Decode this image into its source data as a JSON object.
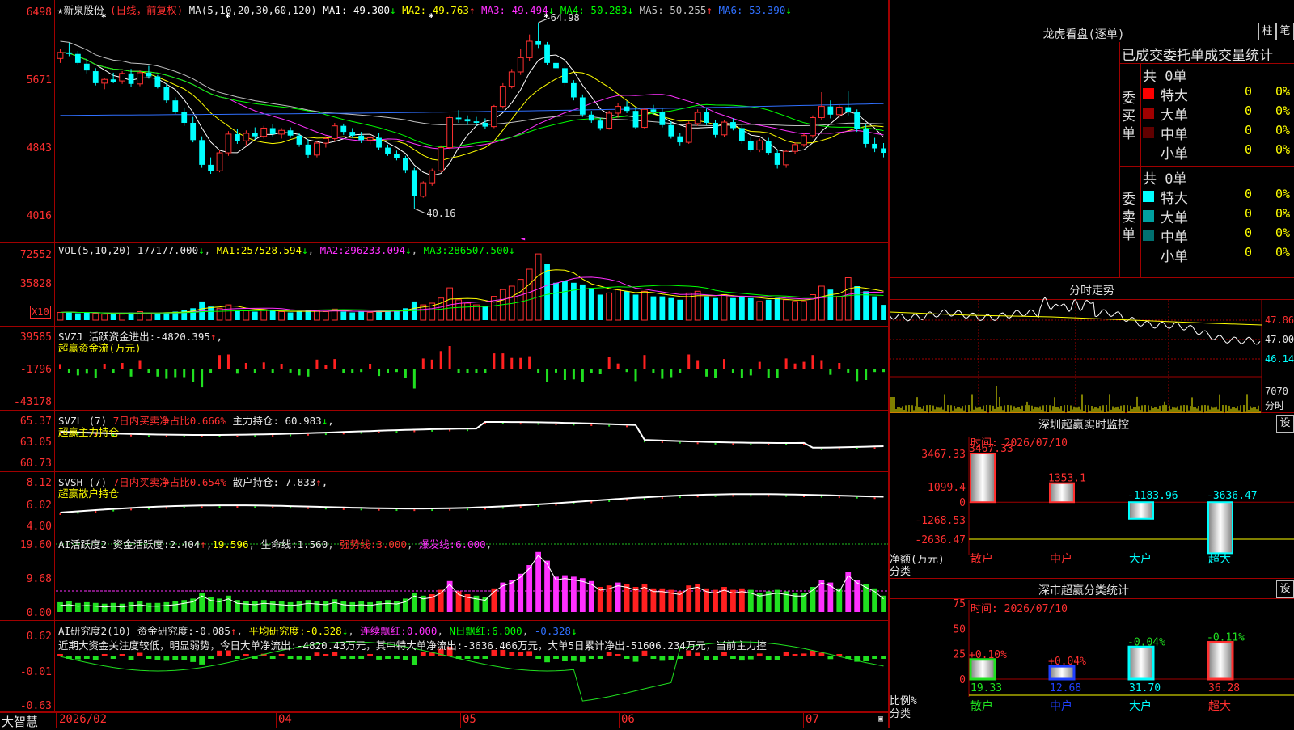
{
  "stock": {
    "name": "新泉股份",
    "period": "(日线，前复权)"
  },
  "main": {
    "ma_title": "MA(5,10,20,30,60,120)",
    "ma": [
      {
        "label": "MA1:",
        "value": "49.300",
        "dir": "↓",
        "color": "#ffffff"
      },
      {
        "label": "MA2:",
        "value": "49.763",
        "dir": "↑",
        "color": "#ffff00"
      },
      {
        "label": "MA3:",
        "value": "49.494",
        "dir": "↓",
        "color": "#ff30ff"
      },
      {
        "label": "MA4:",
        "value": "50.283",
        "dir": "↓",
        "color": "#00ff00"
      },
      {
        "label": "MA5:",
        "value": "50.255",
        "dir": "↑",
        "color": "#c0c0c0"
      },
      {
        "label": "MA6:",
        "value": "53.390",
        "dir": "↓",
        "color": "#3070ff"
      }
    ],
    "y_labels": [
      "6498",
      "5671",
      "4843",
      "4016"
    ],
    "high_mark": "64.98",
    "low_mark": "40.16"
  },
  "vol": {
    "title": "VOL(5,10,20)",
    "value": "177177.000",
    "value_dir": "↓",
    "ma1": "257528.594",
    "ma1_dir": "↓",
    "ma2": "296233.094",
    "ma2_dir": "↓",
    "ma3": "286507.500",
    "ma3_dir": "↓",
    "y_labels": [
      "72552",
      "35828"
    ],
    "unit": "X10"
  },
  "svzj": {
    "title": "SVZJ",
    "text": "活跃资金进出:",
    "value": "-4820.395",
    "dir": "↑",
    "sep": ",",
    "subtitle": "超赢资金流(万元)",
    "y_labels": [
      "39585",
      "-1796",
      "-43178"
    ]
  },
  "svzl": {
    "title": "SVZL (7)",
    "ratio_text": "7日内买卖净占比0.666%",
    "hold_label": "主力持仓:",
    "hold_value": "60.983",
    "dir": "↓",
    "sep": ",",
    "subtitle": "超赢主力持仓",
    "y_labels": [
      "65.37",
      "63.05",
      "60.73"
    ]
  },
  "svsh": {
    "title": "SVSH (7)",
    "ratio_text": "7日内买卖净占比0.654%",
    "hold_label": "散户持仓:",
    "hold_value": "7.833",
    "dir": "↑",
    "sep": ",",
    "subtitle": "超赢散户持仓",
    "y_labels": [
      "8.12",
      "6.02",
      "4.00"
    ]
  },
  "ai_act": {
    "title": "AI活跃度2",
    "act_label": "资金活跃度:",
    "act_value": "2.404",
    "act_dir": "↑",
    "val2": "19.596",
    "life_label": "生命线:",
    "life_value": "1.560",
    "strong_label": "强势线:",
    "strong_value": "3.000",
    "burst_label": "爆发线:",
    "burst_value": "6.000",
    "y_labels": [
      "19.60",
      "9.68",
      "0.00"
    ]
  },
  "ai_res": {
    "title": "AI研究度2(10)",
    "res_label": "资金研究度:",
    "res_value": "-0.085",
    "res_dir": "↑",
    "avg_label": "平均研究度:",
    "avg_value": "-0.328",
    "avg_dir": "↓",
    "lx_label": "连续飘红:",
    "lx_value": "0.000",
    "n_label": "N日飘红:",
    "n_value": "6.000",
    "last_value": "-0.328",
    "last_dir": "↓",
    "comment": "近期大资金关注度较低，明显弱势，今日大单净流出:-4820.43万元，其中特大单净流出:-3636.466万元，大单5日累计净出-51606.234万元，当前主力控",
    "y_labels": [
      "0.62",
      "-0.01",
      "-0.63"
    ]
  },
  "xaxis": {
    "brand": "大智慧",
    "labels": [
      "2026/02",
      "04",
      "05",
      "06",
      "07"
    ]
  },
  "lhb": {
    "title": "龙虎看盘(逐单)",
    "btn1": "柱",
    "btn2": "笔",
    "header": "已成交委托单成交量统计",
    "buy_label": "委买单",
    "sell_label": "委卖单",
    "buy_total": "共 0单",
    "sell_total": "共 0单",
    "buy_rows": [
      {
        "name": "特大",
        "count": "0",
        "pct": "0%",
        "color": "#ff0000"
      },
      {
        "name": "大单",
        "count": "0",
        "pct": "0%",
        "color": "#a00000"
      },
      {
        "name": "中单",
        "count": "0",
        "pct": "0%",
        "color": "#600000"
      },
      {
        "name": "小单",
        "count": "0",
        "pct": "0%",
        "color": ""
      }
    ],
    "sell_rows": [
      {
        "name": "特大",
        "count": "0",
        "pct": "0%",
        "color": "#00ffff"
      },
      {
        "name": "大单",
        "count": "0",
        "pct": "0%",
        "color": "#00a0a0"
      },
      {
        "name": "中单",
        "count": "0",
        "pct": "0%",
        "color": "#007070"
      },
      {
        "name": "小单",
        "count": "0",
        "pct": "0%",
        "color": ""
      }
    ]
  },
  "intraday": {
    "title": "分时走势",
    "y_labels": [
      "47.86",
      "47.00",
      "46.14"
    ],
    "vol_label": "7070",
    "time_label": "分时"
  },
  "sz_monitor": {
    "title": "深圳超赢实时监控",
    "set_btn": "设",
    "time": "时间: 2026/07/10",
    "y_labels": [
      "3467.33",
      "1099.4",
      "0",
      "-1268.53",
      "-2636.47"
    ],
    "unit_label": "净额(万元)",
    "class_label": "分类",
    "bars": [
      {
        "name": "散户",
        "value": 3467.33,
        "label": "3467.33"
      },
      {
        "name": "中户",
        "value": 1353.1,
        "label": "1353.1"
      },
      {
        "name": "大户",
        "value": -1183.96,
        "label": "-1183.96"
      },
      {
        "name": "超大",
        "value": -3636.47,
        "label": "-3636.47"
      }
    ]
  },
  "sz_class": {
    "title": "深市超赢分类统计",
    "set_btn": "设",
    "time": "时间: 2026/07/10",
    "y_labels": [
      "75",
      "50",
      "25",
      "0"
    ],
    "unit_label": "比例%",
    "class_label": "分类",
    "bars": [
      {
        "name": "散户",
        "value": 19.33,
        "label": "19.33",
        "chg": "+0.10%"
      },
      {
        "name": "中户",
        "value": 12.68,
        "label": "12.68",
        "chg": "+0.04%"
      },
      {
        "name": "大户",
        "value": 31.7,
        "label": "31.70",
        "chg": "-0.04%"
      },
      {
        "name": "超大",
        "value": 36.28,
        "label": "36.28",
        "chg": "-0.11%"
      }
    ]
  },
  "chart_data": {
    "type": "candlestick",
    "ohlc": [
      [
        60.2,
        61.5,
        59.6,
        61.0
      ],
      [
        61.0,
        62.3,
        60.5,
        60.8
      ],
      [
        60.8,
        61.2,
        59.4,
        59.6
      ],
      [
        59.5,
        60.2,
        58.2,
        58.6
      ],
      [
        58.5,
        58.9,
        56.6,
        56.9
      ],
      [
        56.9,
        57.6,
        56.1,
        57.4
      ],
      [
        57.4,
        58.3,
        56.9,
        57.1
      ],
      [
        57.2,
        58.5,
        56.8,
        58.2
      ],
      [
        58.2,
        58.8,
        56.4,
        56.8
      ],
      [
        56.8,
        58.6,
        56.5,
        58.3
      ],
      [
        58.3,
        59.2,
        57.5,
        57.8
      ],
      [
        57.8,
        58.0,
        56.2,
        56.4
      ],
      [
        56.4,
        56.8,
        54.2,
        54.6
      ],
      [
        54.6,
        55.0,
        52.8,
        53.1
      ],
      [
        53.1,
        53.6,
        51.2,
        51.6
      ],
      [
        51.6,
        52.4,
        49.0,
        49.3
      ],
      [
        49.3,
        49.8,
        45.6,
        46.0
      ],
      [
        46.0,
        47.0,
        44.8,
        45.2
      ],
      [
        45.2,
        48.0,
        45.0,
        47.6
      ],
      [
        47.6,
        50.5,
        47.2,
        50.1
      ],
      [
        50.1,
        50.8,
        48.8,
        49.2
      ],
      [
        49.2,
        50.6,
        48.6,
        50.2
      ],
      [
        50.2,
        51.0,
        49.4,
        49.8
      ],
      [
        49.8,
        51.2,
        49.5,
        50.9
      ],
      [
        50.9,
        51.4,
        49.8,
        50.1
      ],
      [
        50.1,
        50.9,
        49.5,
        50.6
      ],
      [
        50.6,
        51.0,
        49.6,
        49.9
      ],
      [
        49.9,
        50.3,
        48.4,
        48.7
      ],
      [
        48.7,
        49.4,
        46.9,
        47.3
      ],
      [
        47.3,
        49.2,
        47.0,
        48.9
      ],
      [
        48.9,
        49.8,
        48.3,
        49.5
      ],
      [
        49.5,
        51.6,
        49.2,
        51.2
      ],
      [
        51.2,
        51.5,
        50.0,
        50.4
      ],
      [
        50.4,
        50.9,
        49.6,
        49.9
      ],
      [
        49.9,
        50.4,
        48.9,
        49.3
      ],
      [
        49.3,
        50.0,
        48.7,
        49.6
      ],
      [
        49.6,
        50.2,
        48.0,
        48.3
      ],
      [
        48.3,
        48.7,
        47.2,
        47.5
      ],
      [
        47.5,
        47.9,
        46.6,
        46.9
      ],
      [
        46.9,
        47.2,
        44.9,
        45.3
      ],
      [
        45.3,
        45.6,
        40.16,
        41.8
      ],
      [
        41.8,
        43.8,
        41.6,
        43.6
      ],
      [
        43.6,
        45.5,
        43.2,
        45.2
      ],
      [
        45.2,
        48.6,
        45.0,
        48.3
      ],
      [
        48.3,
        52.6,
        48.1,
        52.3
      ],
      [
        52.3,
        53.3,
        51.6,
        52.1
      ],
      [
        52.1,
        52.6,
        51.3,
        51.8
      ],
      [
        51.8,
        52.4,
        51.2,
        51.6
      ],
      [
        51.6,
        52.2,
        50.8,
        51.1
      ],
      [
        51.1,
        54.0,
        50.9,
        53.8
      ],
      [
        53.8,
        56.9,
        53.5,
        56.5
      ],
      [
        56.5,
        58.8,
        56.2,
        58.4
      ],
      [
        58.4,
        61.5,
        58.0,
        60.3
      ],
      [
        60.3,
        63.4,
        59.8,
        62.5
      ],
      [
        62.5,
        64.98,
        61.6,
        62.0
      ],
      [
        62.0,
        62.4,
        59.3,
        59.6
      ],
      [
        59.6,
        60.2,
        58.6,
        58.9
      ],
      [
        58.9,
        59.3,
        56.5,
        56.9
      ],
      [
        56.9,
        57.3,
        54.6,
        55.0
      ],
      [
        55.0,
        55.4,
        52.4,
        52.7
      ],
      [
        52.7,
        53.2,
        51.6,
        51.9
      ],
      [
        51.9,
        52.3,
        50.6,
        50.9
      ],
      [
        50.9,
        53.2,
        50.7,
        52.9
      ],
      [
        52.9,
        54.2,
        52.3,
        53.8
      ],
      [
        53.8,
        54.5,
        52.9,
        53.2
      ],
      [
        53.2,
        53.7,
        50.8,
        51.0
      ],
      [
        51.0,
        53.6,
        50.8,
        53.4
      ],
      [
        53.4,
        54.0,
        52.7,
        53.1
      ],
      [
        53.1,
        53.5,
        51.0,
        51.3
      ],
      [
        51.3,
        51.8,
        49.5,
        49.8
      ],
      [
        49.8,
        50.3,
        48.6,
        49.0
      ],
      [
        49.0,
        51.8,
        48.8,
        51.5
      ],
      [
        51.5,
        53.4,
        51.2,
        53.0
      ],
      [
        53.0,
        53.5,
        51.3,
        51.6
      ],
      [
        51.6,
        52.0,
        49.6,
        50.0
      ],
      [
        50.0,
        52.0,
        49.7,
        51.7
      ],
      [
        51.7,
        52.2,
        50.6,
        50.9
      ],
      [
        50.9,
        51.5,
        48.8,
        49.2
      ],
      [
        49.2,
        49.7,
        47.7,
        48.0
      ],
      [
        48.0,
        49.5,
        47.7,
        49.2
      ],
      [
        49.2,
        49.6,
        47.3,
        47.6
      ],
      [
        47.6,
        48.0,
        45.5,
        46.0
      ],
      [
        46.0,
        48.0,
        45.6,
        47.8
      ],
      [
        47.8,
        49.0,
        47.5,
        48.7
      ],
      [
        48.7,
        50.2,
        48.4,
        49.9
      ],
      [
        49.9,
        52.6,
        49.6,
        52.3
      ],
      [
        52.3,
        55.7,
        52.0,
        53.8
      ],
      [
        53.8,
        54.6,
        52.2,
        52.7
      ],
      [
        52.7,
        54.0,
        52.3,
        53.7
      ],
      [
        53.7,
        55.8,
        52.6,
        53.0
      ],
      [
        53.0,
        53.4,
        50.4,
        50.8
      ],
      [
        50.8,
        51.4,
        48.3,
        48.8
      ],
      [
        48.8,
        49.6,
        47.7,
        48.2
      ],
      [
        48.2,
        48.9,
        47.0,
        47.6
      ]
    ],
    "volume": [
      [
        9,
        1
      ],
      [
        10,
        0
      ],
      [
        8,
        0
      ],
      [
        9,
        0
      ],
      [
        8,
        1
      ],
      [
        7,
        1
      ],
      [
        8,
        0
      ],
      [
        7,
        1
      ],
      [
        9,
        0
      ],
      [
        10,
        1
      ],
      [
        8,
        1
      ],
      [
        8,
        0
      ],
      [
        9,
        0
      ],
      [
        10,
        0
      ],
      [
        12,
        0
      ],
      [
        14,
        0
      ],
      [
        22,
        0
      ],
      [
        16,
        0
      ],
      [
        14,
        1
      ],
      [
        18,
        1
      ],
      [
        12,
        0
      ],
      [
        11,
        1
      ],
      [
        10,
        0
      ],
      [
        12,
        1
      ],
      [
        11,
        0
      ],
      [
        10,
        1
      ],
      [
        9,
        0
      ],
      [
        10,
        0
      ],
      [
        12,
        0
      ],
      [
        11,
        1
      ],
      [
        10,
        1
      ],
      [
        13,
        1
      ],
      [
        10,
        0
      ],
      [
        9,
        0
      ],
      [
        10,
        0
      ],
      [
        9,
        1
      ],
      [
        11,
        0
      ],
      [
        12,
        0
      ],
      [
        11,
        0
      ],
      [
        14,
        0
      ],
      [
        22,
        0
      ],
      [
        18,
        1
      ],
      [
        20,
        1
      ],
      [
        26,
        1
      ],
      [
        38,
        1
      ],
      [
        24,
        1
      ],
      [
        20,
        1
      ],
      [
        18,
        1
      ],
      [
        16,
        0
      ],
      [
        28,
        1
      ],
      [
        36,
        1
      ],
      [
        40,
        1
      ],
      [
        48,
        1
      ],
      [
        60,
        1
      ],
      [
        78,
        1
      ],
      [
        66,
        0
      ],
      [
        44,
        0
      ],
      [
        46,
        0
      ],
      [
        44,
        0
      ],
      [
        42,
        0
      ],
      [
        38,
        0
      ],
      [
        30,
        0
      ],
      [
        32,
        1
      ],
      [
        36,
        1
      ],
      [
        34,
        0
      ],
      [
        30,
        0
      ],
      [
        34,
        1
      ],
      [
        28,
        0
      ],
      [
        28,
        0
      ],
      [
        26,
        0
      ],
      [
        24,
        0
      ],
      [
        32,
        1
      ],
      [
        34,
        1
      ],
      [
        28,
        0
      ],
      [
        26,
        0
      ],
      [
        30,
        1
      ],
      [
        26,
        0
      ],
      [
        28,
        0
      ],
      [
        26,
        0
      ],
      [
        22,
        1
      ],
      [
        24,
        0
      ],
      [
        26,
        0
      ],
      [
        24,
        1
      ],
      [
        22,
        1
      ],
      [
        22,
        1
      ],
      [
        30,
        1
      ],
      [
        40,
        1
      ],
      [
        36,
        0
      ],
      [
        28,
        1
      ],
      [
        50,
        1
      ],
      [
        40,
        0
      ],
      [
        34,
        0
      ],
      [
        28,
        0
      ],
      [
        18,
        0
      ]
    ]
  }
}
